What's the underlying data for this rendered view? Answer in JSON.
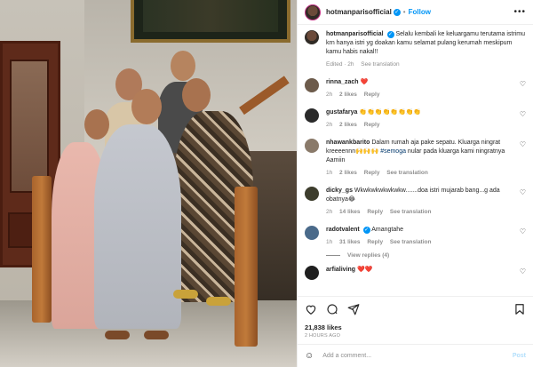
{
  "header": {
    "username": "hotmanparisofficial",
    "separator": "•",
    "follow_label": "Follow",
    "more_icon": "more-horizontal-icon"
  },
  "caption": {
    "username": "hotmanparisofficial",
    "text": "Selalu kembali ke keluargamu terutama istrimu krn hanya istri yg doakan kamu selamat pulang kerumah meskipum kamu habis nakal!!",
    "edited": "Edited · 2h",
    "see_translation": "See translation"
  },
  "comments": [
    {
      "username": "rinna_zach",
      "text": "❤️",
      "time": "2h",
      "likes": "2 likes",
      "reply": "Reply",
      "translate": "",
      "avatar_color": "#6d5b4b"
    },
    {
      "username": "gustafarya",
      "text": "👏👏👏👏👏👏👏👏",
      "time": "2h",
      "likes": "2 likes",
      "reply": "Reply",
      "translate": "",
      "avatar_color": "#2a2a2a"
    },
    {
      "username": "nhawankbarito",
      "text": "Dalam rumah aja pake sepatu. Kluarga ningrat kreeeennn🙌🙌🙌",
      "hashtag": "#semoga",
      "text2": " nular pada kluarga kami ningratnya Aamiin",
      "time": "1h",
      "likes": "2 likes",
      "reply": "Reply",
      "translate": "See translation",
      "avatar_color": "#8a7a6a"
    },
    {
      "username": "dicky_gs",
      "text": "Wkwkwkwkwkwkw.......doa istri mujarab bang...g ada obatnya😂",
      "time": "2h",
      "likes": "14 likes",
      "reply": "Reply",
      "translate": "See translation",
      "avatar_color": "#3d3d2d"
    },
    {
      "username": "radotvalent",
      "text": "Amangtahe",
      "time": "1h",
      "likes": "31 likes",
      "reply": "Reply",
      "translate": "See translation",
      "avatar_color": "#4a6a8a",
      "view_replies": "View replies (4)"
    },
    {
      "username": "arfialiving",
      "text": "❤️❤️",
      "time": "",
      "likes": "",
      "reply": "",
      "translate": "",
      "avatar_color": "#1f1f1f"
    }
  ],
  "actions": {
    "icons": [
      "heart-icon",
      "comment-icon",
      "share-icon",
      "save-icon"
    ],
    "likes": "21,838 likes",
    "ago": "2 HOURS AGO"
  },
  "add_comment": {
    "placeholder": "Add a comment...",
    "post_label": "Post",
    "emoji_icon": "emoji-icon"
  },
  "colors": {
    "link_blue": "#0095f6",
    "muted": "#8e8e8e",
    "text": "#262626"
  }
}
